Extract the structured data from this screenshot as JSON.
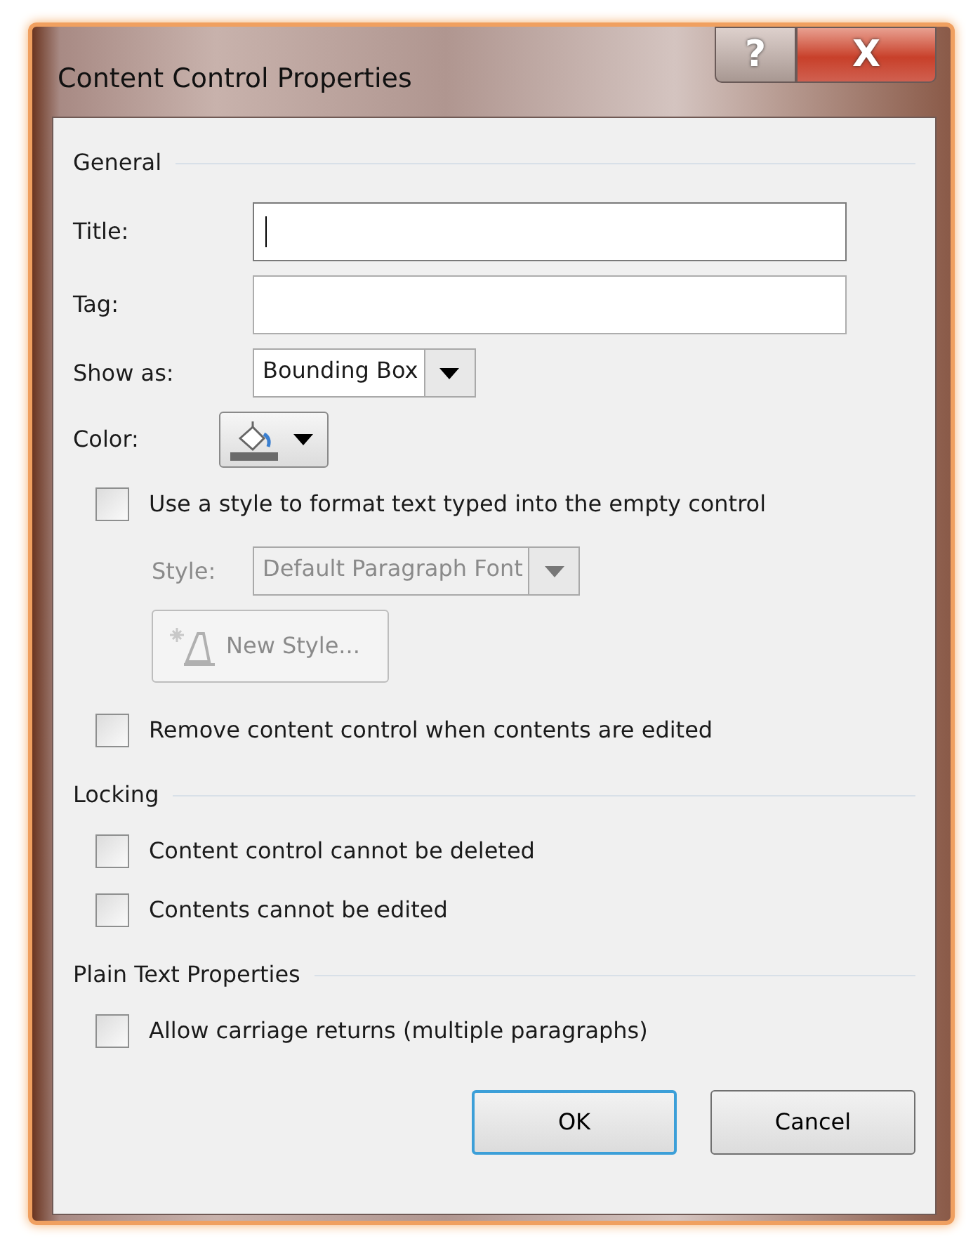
{
  "window": {
    "title": "Content Control Properties",
    "help_button": "?",
    "close_button": "X"
  },
  "sections": [
    {
      "heading": "General",
      "items": [
        {
          "kind": "text_field",
          "label": "Title:",
          "focused": true
        },
        {
          "kind": "text_field",
          "label": "Tag:",
          "focused": false
        },
        {
          "kind": "dropdown",
          "label": "Show as:",
          "value": "Bounding Box",
          "disabled": false
        },
        {
          "kind": "color_picker",
          "label": "Color:"
        },
        {
          "kind": "checkbox",
          "label": "Use a style to format text typed into the empty control",
          "checked": false,
          "children": [
            {
              "kind": "dropdown",
              "label": "Style:",
              "value": "Default Paragraph Font",
              "disabled": true
            },
            {
              "kind": "button",
              "label": "New Style...",
              "disabled": true
            }
          ]
        },
        {
          "kind": "checkbox",
          "label": "Remove content control when contents are edited",
          "checked": false
        }
      ]
    },
    {
      "heading": "Locking",
      "items": [
        {
          "kind": "checkbox",
          "label": "Content control cannot be deleted",
          "checked": false
        },
        {
          "kind": "checkbox",
          "label": "Contents cannot be edited",
          "checked": false
        }
      ]
    },
    {
      "heading": "Plain Text Properties",
      "items": [
        {
          "kind": "checkbox",
          "label": "Allow carriage returns (multiple paragraphs)",
          "checked": false
        }
      ]
    }
  ],
  "buttons": [
    {
      "label": "OK",
      "default": true
    },
    {
      "label": "Cancel",
      "default": false
    }
  ]
}
